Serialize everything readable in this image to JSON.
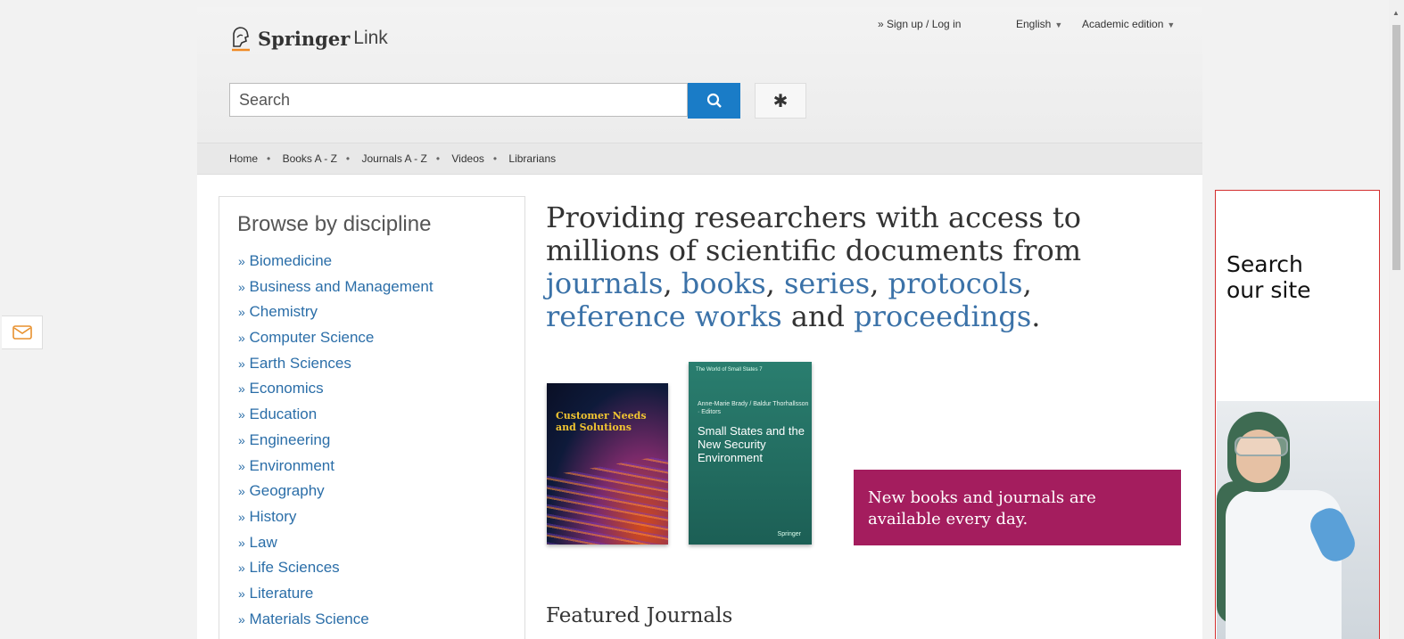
{
  "header": {
    "brand": "Springer",
    "brand_sub": "Link",
    "sign_up": "» Sign up / Log in",
    "language": "English",
    "edition": "Academic edition",
    "search_placeholder": "Search"
  },
  "nav": {
    "items": [
      "Home",
      "Books A - Z",
      "Journals A - Z",
      "Videos",
      "Librarians"
    ]
  },
  "browse": {
    "title": "Browse by discipline",
    "items": [
      "Biomedicine",
      "Business and Management",
      "Chemistry",
      "Computer Science",
      "Earth Sciences",
      "Economics",
      "Education",
      "Engineering",
      "Environment",
      "Geography",
      "History",
      "Law",
      "Life Sciences",
      "Literature",
      "Materials Science"
    ],
    "prefix": "»"
  },
  "hero": {
    "line1": "Providing researchers with access to",
    "line2": "millions of scientific documents from",
    "journals": "journals",
    "books": "books",
    "series": "series",
    "protocols": "protocols",
    "reference_works": "reference works",
    "and": "and",
    "proceedings": "proceedings"
  },
  "books": {
    "book1_title": "Customer Needs and Solutions",
    "book2_series": "The World of Small States 7",
    "book2_editors": "Anne-Marie Brady / Baldur Thorhallsson · Editors",
    "book2_title": "Small States and the New Security Environment",
    "book2_publisher": "Springer"
  },
  "promo": {
    "text": "New books and journals are available every day."
  },
  "featured": {
    "title": "Featured Journals"
  },
  "ad": {
    "text_line1": "Search",
    "text_line2": "our site"
  },
  "colors": {
    "link": "#2b6ea8",
    "search_button": "#1a7cc7",
    "promo_bg": "#a41d5e",
    "ad_border": "#d32f2f"
  }
}
